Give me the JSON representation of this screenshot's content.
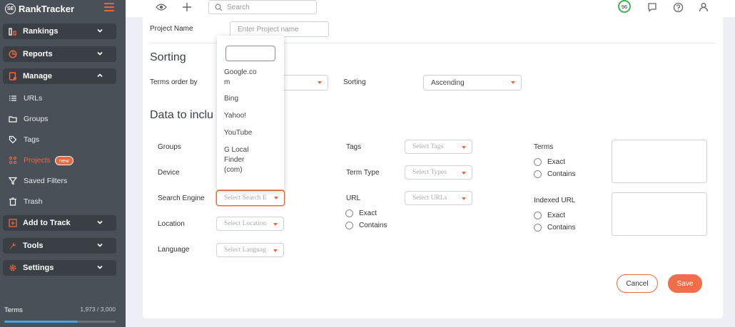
{
  "app": {
    "logo_text": "RankTracker",
    "logo_sup": "SE"
  },
  "sidebar": {
    "groups": [
      {
        "label": "Rankings",
        "icon": "rankings-bars-icon"
      },
      {
        "label": "Reports",
        "icon": "pie-chart-icon"
      },
      {
        "label": "Manage",
        "icon": "manage-icon"
      },
      {
        "label": "Add to Track",
        "icon": "plus-square-icon"
      },
      {
        "label": "Tools",
        "icon": "wrench-icon"
      },
      {
        "label": "Settings",
        "icon": "gear-icon"
      }
    ],
    "sub_items": [
      {
        "label": "URLs",
        "icon": "list-icon"
      },
      {
        "label": "Groups",
        "icon": "folder-icon"
      },
      {
        "label": "Tags",
        "icon": "tag-icon"
      },
      {
        "label": "Projects",
        "icon": "projects-icon",
        "badge": "new"
      },
      {
        "label": "Saved Filters",
        "icon": "filter-icon"
      },
      {
        "label": "Trash",
        "icon": "trash-icon"
      }
    ],
    "terms_label": "Terms",
    "terms_count": "1,973 / 3,000",
    "terms_progress": 0.658
  },
  "topbar": {
    "search_placeholder": "Search",
    "score": "96"
  },
  "form": {
    "project_name_label": "Project Name",
    "project_name_placeholder": "Enter Project name",
    "sorting_title": "Sorting",
    "terms_order_label": "Terms order by",
    "sorting_label": "Sorting",
    "sorting_value": "Ascending",
    "data_title": "Data to inclu",
    "groups_label": "Groups",
    "device_label": "Device",
    "search_engine_label": "Search Engine",
    "search_engine_placeholder": "Select Search E",
    "location_label": "Location",
    "location_placeholder": "Select Location",
    "language_label": "Language",
    "language_placeholder": "Select Languag",
    "tags_label": "Tags",
    "tags_placeholder": "Select Tags",
    "term_type_label": "Term Type",
    "term_type_placeholder": "Select Types",
    "url_label": "URL",
    "url_placeholder": "Select URLs",
    "url_exact": "Exact",
    "url_contains": "Contains",
    "terms_label": "Terms",
    "terms_exact": "Exact",
    "terms_contains": "Contains",
    "indexed_url_label": "Indexed URL",
    "indexed_exact": "Exact",
    "indexed_contains": "Contains",
    "cancel_label": "Cancel",
    "save_label": "Save"
  },
  "dropdown": {
    "options": [
      {
        "lines": [
          "Google.co",
          "m"
        ]
      },
      {
        "lines": [
          "Bing"
        ]
      },
      {
        "lines": [
          "Yahoo!"
        ]
      },
      {
        "lines": [
          "YouTube"
        ]
      },
      {
        "lines": [
          "G Local",
          "Finder",
          "(com)"
        ]
      }
    ]
  },
  "colors": {
    "accent": "#f0663a",
    "sidebar_bg": "#4a5058",
    "sidebar_group_bg": "#3a3f46",
    "score_ring": "#3fb34f",
    "progress": "#4aa3df"
  }
}
